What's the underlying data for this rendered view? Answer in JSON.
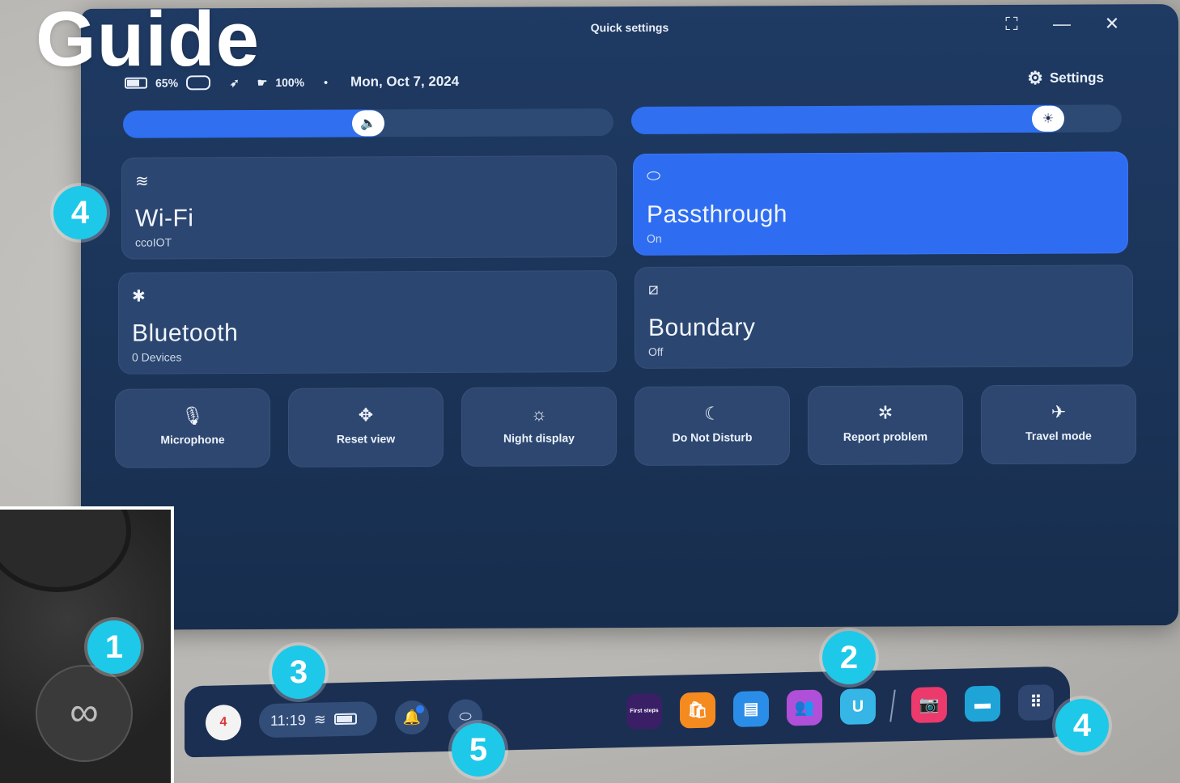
{
  "overlay": {
    "guide_title": "Guide",
    "badges": [
      "4",
      "1",
      "2",
      "3",
      "4",
      "5"
    ]
  },
  "window": {
    "title": "Quick settings",
    "controls": {
      "expand": "⛶",
      "minimize": "—",
      "close": "✕"
    }
  },
  "status": {
    "headset_battery": "65%",
    "controller_battery": "100%",
    "separator": "•",
    "date": "Mon, Oct 7, 2024",
    "settings_label": "Settings"
  },
  "sliders": {
    "volume": {
      "icon": "volume-icon",
      "glyph": "🔈",
      "level": 0.5
    },
    "brightness": {
      "icon": "brightness-icon",
      "glyph": "☀",
      "level": 0.85
    }
  },
  "tiles": [
    {
      "name": "Wi-Fi",
      "sub": "ccoIOT",
      "icon": "wifi-icon",
      "glyph": "≋",
      "active": false
    },
    {
      "name": "Passthrough",
      "sub": "On",
      "icon": "passthrough-icon",
      "glyph": "⬭",
      "active": true
    },
    {
      "name": "Bluetooth",
      "sub": "0 Devices",
      "icon": "bluetooth-icon",
      "glyph": "✱",
      "active": false
    },
    {
      "name": "Boundary",
      "sub": "Off",
      "icon": "boundary-icon",
      "glyph": "⧄",
      "active": false
    }
  ],
  "quick_buttons": [
    {
      "label": "Microphone",
      "icon": "microphone-icon",
      "glyph": "🎙"
    },
    {
      "label": "Reset view",
      "icon": "move-icon",
      "glyph": "✥"
    },
    {
      "label": "Night display",
      "icon": "night-display-icon",
      "glyph": "☼"
    },
    {
      "label": "Do Not Disturb",
      "icon": "moon-icon",
      "glyph": "☾"
    },
    {
      "label": "Report problem",
      "icon": "bug-icon",
      "glyph": "✲"
    },
    {
      "label": "Travel mode",
      "icon": "airplane-icon",
      "glyph": "✈"
    }
  ],
  "taskbar": {
    "avatar": "4",
    "time": "11:19",
    "notifications_icon": "bell-icon",
    "passthrough_icon": "passthrough-icon",
    "apps": [
      {
        "name": "first-steps",
        "label": "First steps",
        "color": "#3a1f66"
      },
      {
        "name": "store",
        "label": "🛍",
        "color": "#f58a1f"
      },
      {
        "name": "browser",
        "label": "▤",
        "color": "#2a8ee8"
      },
      {
        "name": "people",
        "label": "👥",
        "color": "#b04fd8"
      },
      {
        "name": "u-app",
        "label": "U",
        "color": "#36b6e6"
      },
      {
        "name": "camera",
        "label": "📷",
        "color": "#ec3a6c"
      },
      {
        "name": "files",
        "label": "▬",
        "color": "#1fa4d8"
      },
      {
        "name": "library",
        "label": "⠿",
        "color": "#2e4670"
      }
    ]
  },
  "controller_button_glyph": "∞"
}
